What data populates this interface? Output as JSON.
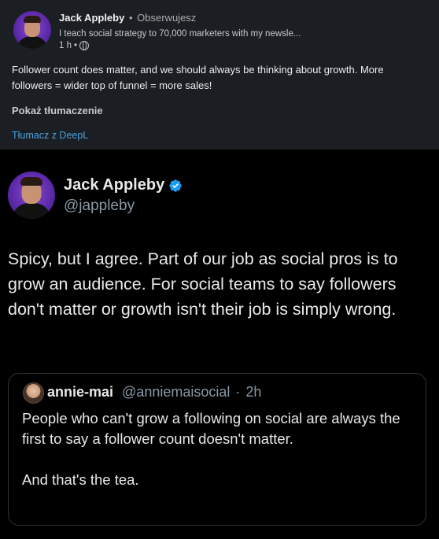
{
  "linkedin_post": {
    "author_name": "Jack Appleby",
    "follow_status": "Obserwujesz",
    "headline": "I teach social strategy to 70,000 marketers with my newsle...",
    "time": "1 h",
    "body": "Follower count does matter, and we should always be thinking about growth. More followers = wider top of funnel = more sales!",
    "show_translation_label": "Pokaż tłumaczenie",
    "deepl_label": "Tłumacz z DeepL",
    "link_color": "#4a9fe0"
  },
  "tweet": {
    "display_name": "Jack Appleby",
    "handle": "@jappleby",
    "verified": true,
    "text": "Spicy, but I agree. Part of our job as social pros is to grow an audience. For social teams to say followers don't matter or growth isn't their job is simply wrong.",
    "quoted": {
      "display_name": "annie-mai",
      "handle": "@anniemaisocial",
      "time": "2h",
      "paragraph_1": "People who can't grow a following on social are always the first to say a follower count doesn't matter.",
      "paragraph_2": "And that's the tea."
    }
  },
  "colors": {
    "linkedin_bg": "#1b1f23",
    "twitter_bg": "#000000",
    "verified_blue": "#1d9bf0",
    "secondary_text": "#8b98a5"
  }
}
